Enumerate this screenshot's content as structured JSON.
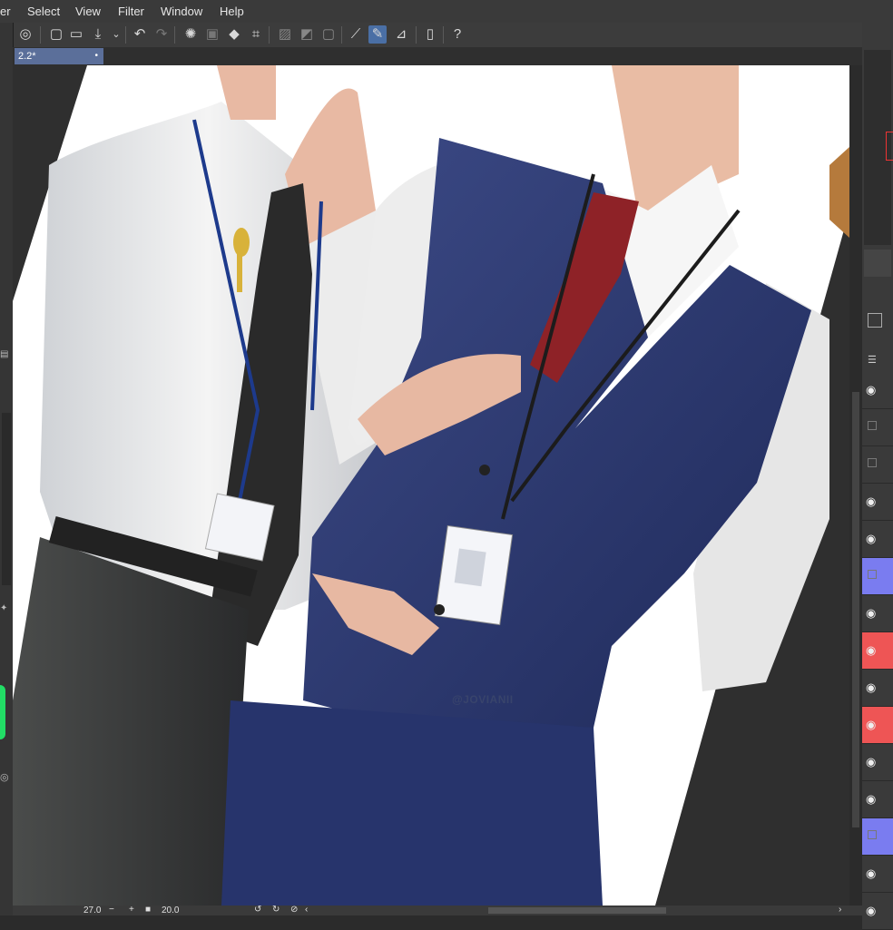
{
  "menu": {
    "items": [
      "er",
      "Select",
      "View",
      "Filter",
      "Window",
      "Help"
    ]
  },
  "document_tab": {
    "title": "2.2*",
    "modified_dot": "•"
  },
  "status": {
    "zoom": "27.0",
    "rotation": "20.0"
  },
  "canvas": {
    "watermark": "@JOVIANII"
  },
  "colors": {
    "tab_active": "#5b6f9a",
    "layer_blue": "#7a7cf0",
    "layer_red": "#ee5555"
  },
  "layers": [
    {
      "visible": true,
      "color": "none"
    },
    {
      "visible": false,
      "color": "none"
    },
    {
      "visible": false,
      "color": "none"
    },
    {
      "visible": true,
      "color": "none"
    },
    {
      "visible": true,
      "color": "none"
    },
    {
      "visible": false,
      "color": "blue"
    },
    {
      "visible": true,
      "color": "none"
    },
    {
      "visible": true,
      "color": "red"
    },
    {
      "visible": true,
      "color": "none"
    },
    {
      "visible": true,
      "color": "red"
    },
    {
      "visible": true,
      "color": "none"
    },
    {
      "visible": true,
      "color": "none"
    },
    {
      "visible": false,
      "color": "blue"
    },
    {
      "visible": true,
      "color": "none"
    },
    {
      "visible": true,
      "color": "none"
    }
  ]
}
